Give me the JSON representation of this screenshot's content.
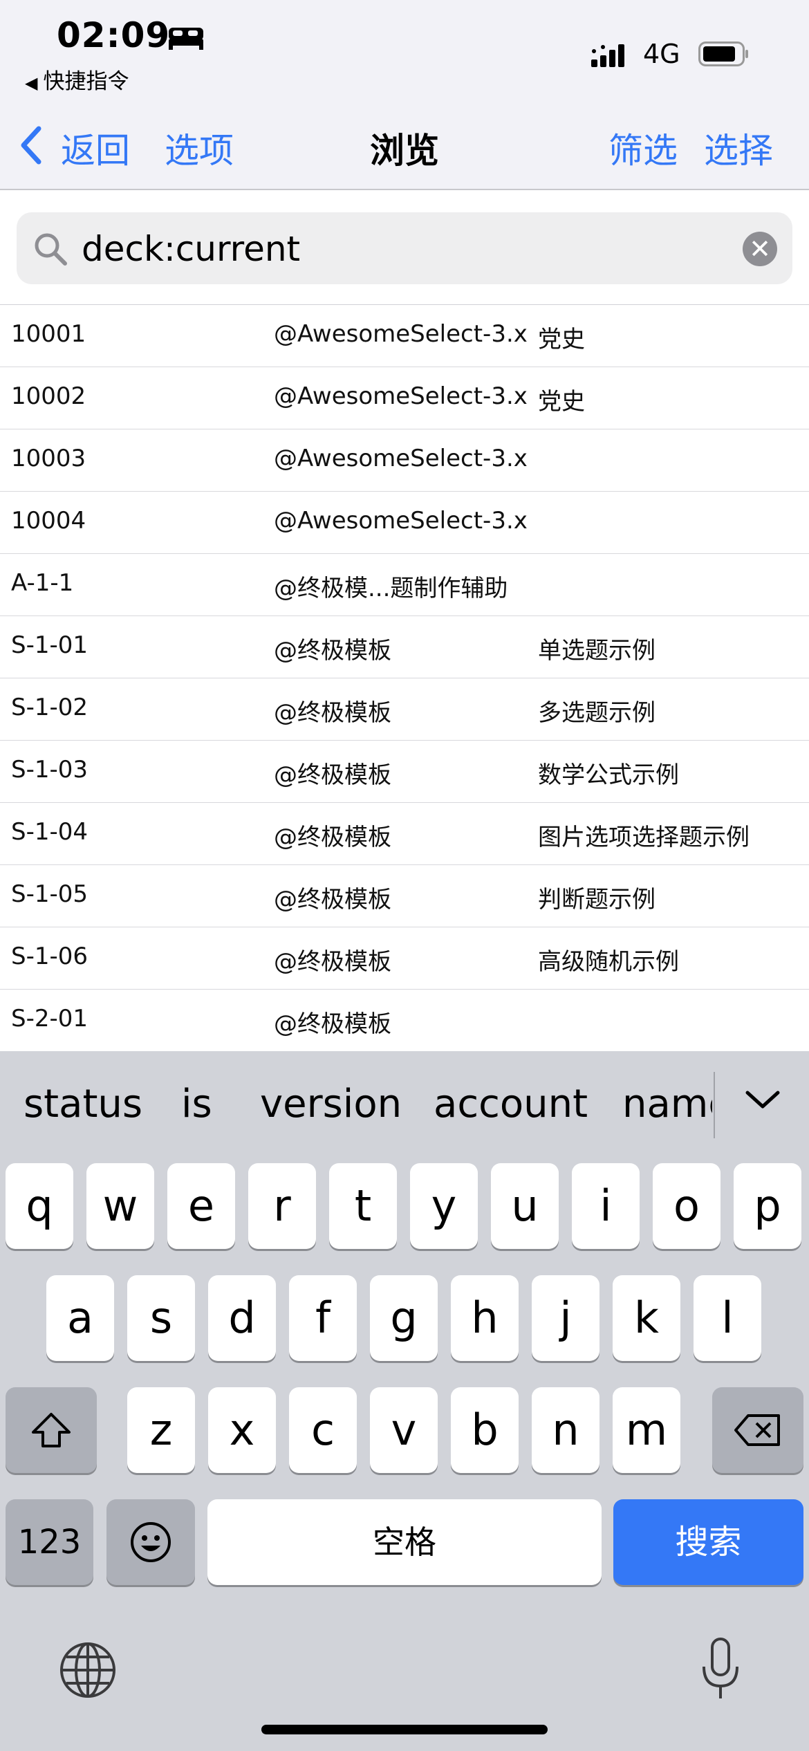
{
  "status_bar": {
    "time": "02:09",
    "back_app": "快捷指令",
    "back_arrow": "◀",
    "network": "4G",
    "icons": [
      "bed-icon",
      "signal-icon",
      "battery-icon"
    ]
  },
  "nav": {
    "back_label": "返回",
    "options_label": "选项",
    "title": "浏览",
    "filter_label": "筛选",
    "select_label": "选择"
  },
  "search": {
    "value": "deck:current",
    "clear_glyph": "✕"
  },
  "table": {
    "rows": [
      [
        "10001",
        "@AwesomeSelect-3.x",
        "党史"
      ],
      [
        "10002",
        "@AwesomeSelect-3.x",
        "党史"
      ],
      [
        "10003",
        "@AwesomeSelect-3.x",
        ""
      ],
      [
        "10004",
        "@AwesomeSelect-3.x",
        ""
      ],
      [
        "A-1-1",
        "@终极模...题制作辅助",
        ""
      ],
      [
        "S-1-01",
        "@终极模板",
        "单选题示例"
      ],
      [
        "S-1-02",
        "@终极模板",
        "多选题示例"
      ],
      [
        "S-1-03",
        "@终极模板",
        "数学公式示例"
      ],
      [
        "S-1-04",
        "@终极模板",
        "图片选项选择题示例"
      ],
      [
        "S-1-05",
        "@终极模板",
        "判断题示例"
      ],
      [
        "S-1-06",
        "@终极模板",
        "高级随机示例"
      ],
      [
        "S-2-01",
        "@终极模板",
        ""
      ]
    ]
  },
  "keyboard": {
    "suggestions": [
      "status",
      "is",
      "version",
      "account",
      "name"
    ],
    "row1": [
      "q",
      "w",
      "e",
      "r",
      "t",
      "y",
      "u",
      "i",
      "o",
      "p"
    ],
    "row2": [
      "a",
      "s",
      "d",
      "f",
      "g",
      "h",
      "j",
      "k",
      "l"
    ],
    "row3": [
      "z",
      "x",
      "c",
      "v",
      "b",
      "n",
      "m"
    ],
    "numbers_label": "123",
    "space_label": "空格",
    "search_label": "搜索",
    "accent_color": "#3478f6"
  }
}
